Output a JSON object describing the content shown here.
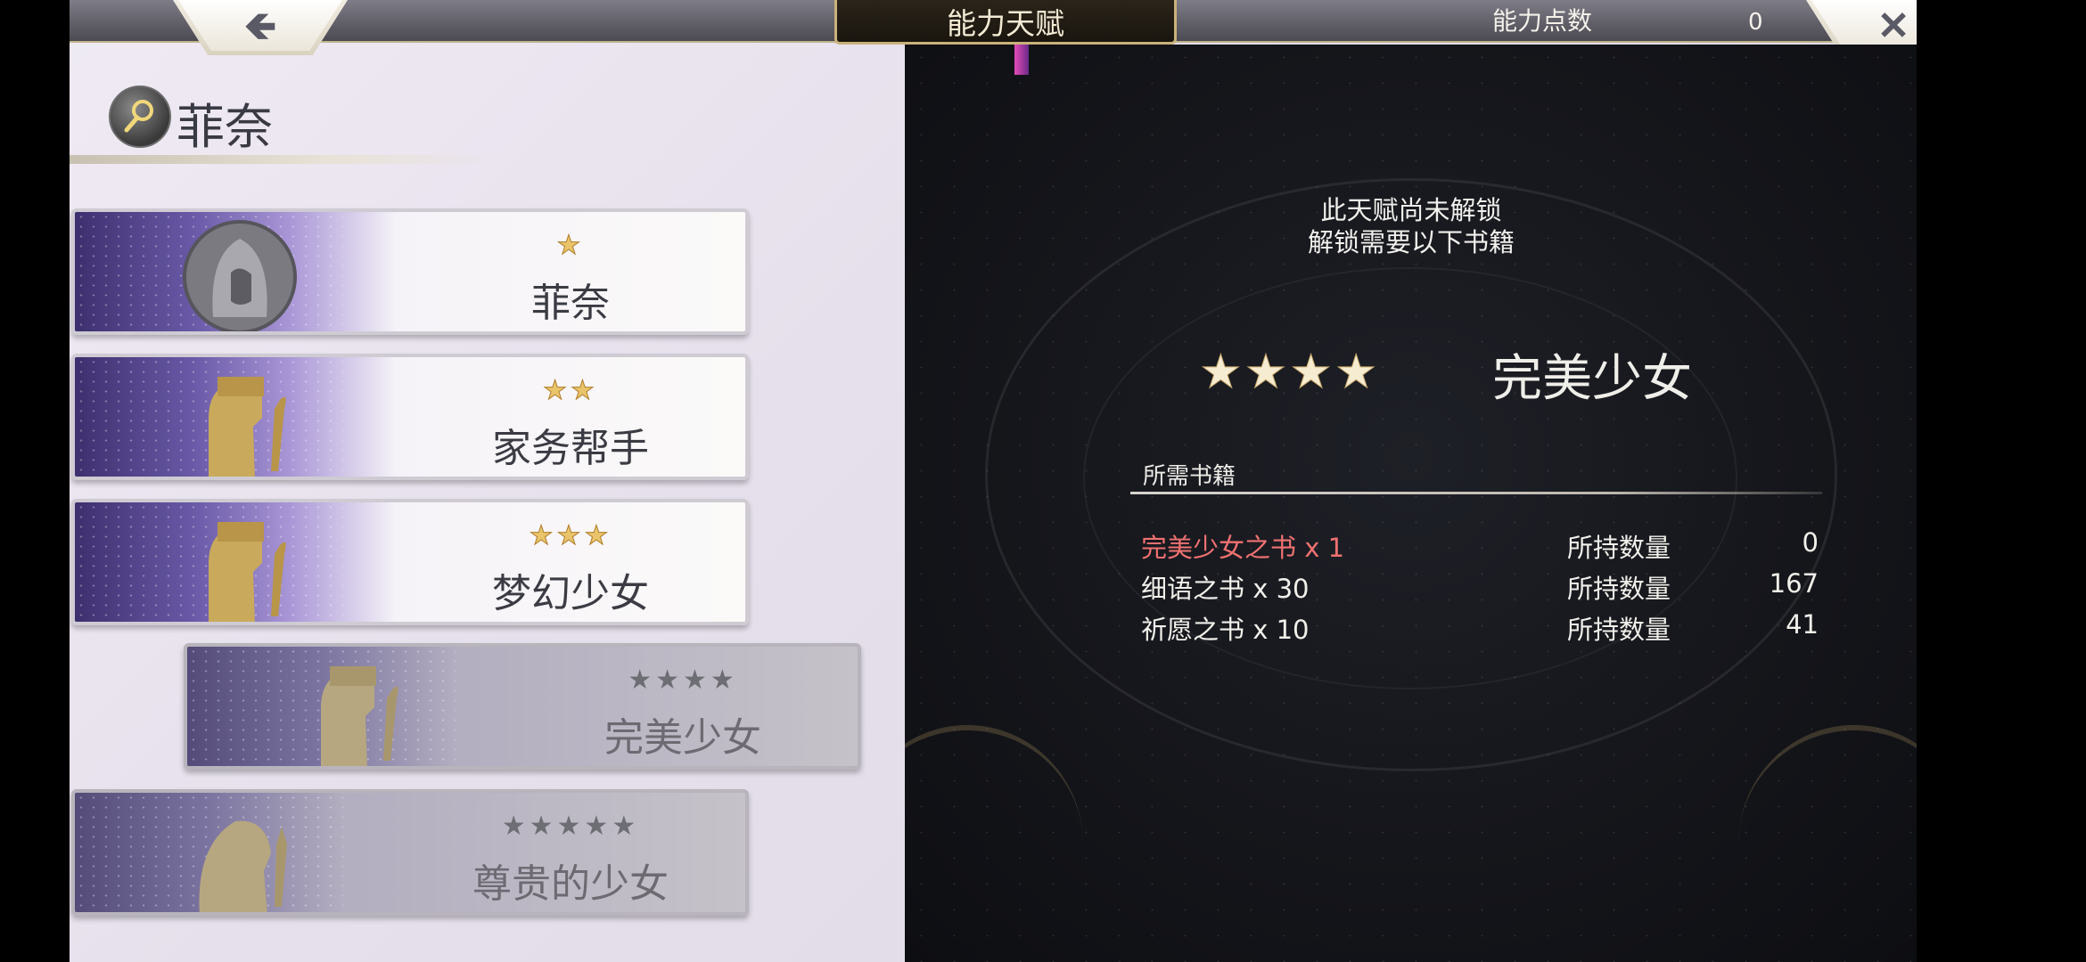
{
  "header": {
    "title": "能力天赋",
    "points_label": "能力点数",
    "points_value": "0",
    "back_icon": "arrow-left-icon",
    "close_icon": "close-icon"
  },
  "character": {
    "name": "菲奈",
    "icon": "character-emblem-icon"
  },
  "talents": [
    {
      "stars": "★",
      "name": "菲奈",
      "locked": false
    },
    {
      "stars": "★★",
      "name": "家务帮手",
      "locked": false
    },
    {
      "stars": "★★★",
      "name": "梦幻少女",
      "locked": false
    },
    {
      "stars": "★★★★",
      "name": "完美少女",
      "locked": true,
      "selected": true
    },
    {
      "stars": "★★★★★",
      "name": "尊贵的少女",
      "locked": true
    }
  ],
  "detail": {
    "locked_line1": "此天赋尚未解锁",
    "locked_line2": "解锁需要以下书籍",
    "stars": "★★★★",
    "title": "完美少女",
    "books_header": "所需书籍",
    "books": [
      {
        "name": "完美少女之书 x 1",
        "owned_label": "所持数量",
        "owned": "0",
        "missing": true
      },
      {
        "name": "细语之书 x 30",
        "owned_label": "所持数量",
        "owned": "167",
        "missing": false
      },
      {
        "name": "祈愿之书 x 10",
        "owned_label": "所持数量",
        "owned": "41",
        "missing": false
      }
    ]
  },
  "colors": {
    "star_gold": "#e9c46a",
    "missing_red": "#f07171",
    "panel_bg": "#15161b"
  }
}
